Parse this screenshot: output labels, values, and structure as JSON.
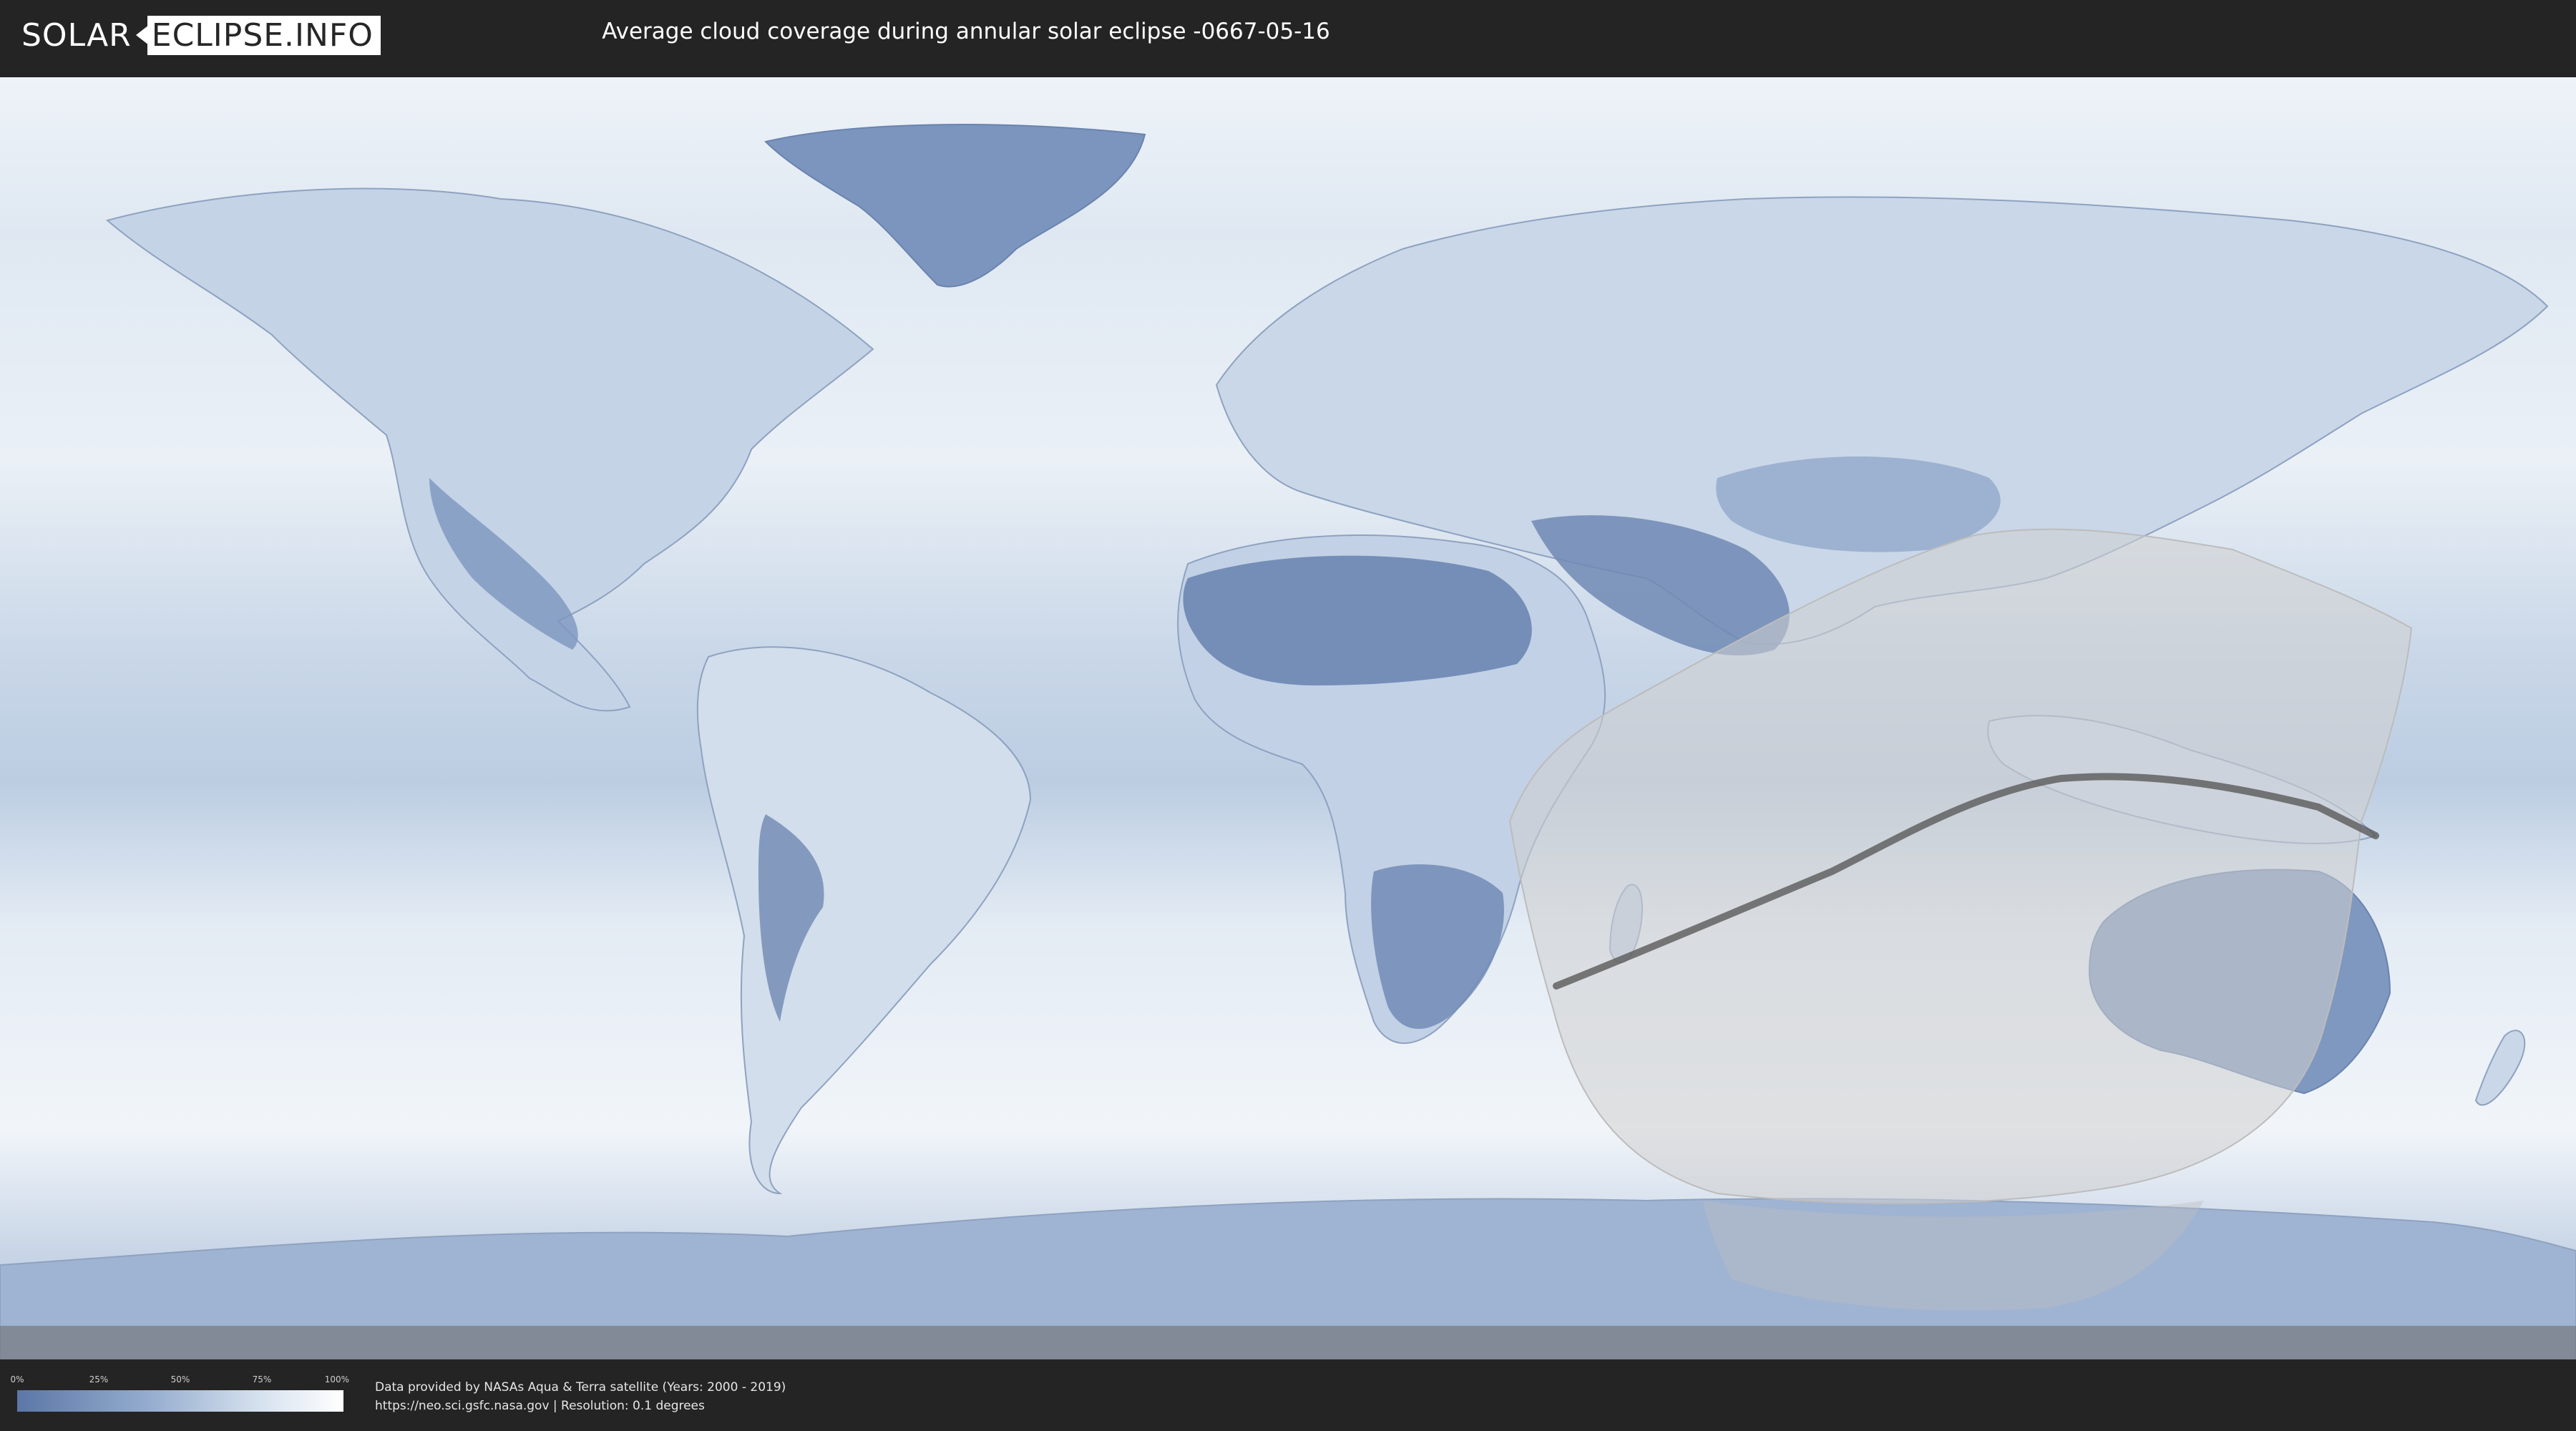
{
  "logo": {
    "left": "SOLAR",
    "right": "ECLIPSE.INFO"
  },
  "title": "Average cloud coverage during annular solar eclipse -0667-05-16",
  "legend": {
    "ticks": [
      "0%",
      "25%",
      "50%",
      "75%",
      "100%"
    ],
    "colors": {
      "low": "#5b77a6",
      "mid": "#94acce",
      "high": "#ffffff"
    }
  },
  "credits": {
    "line1": "Data provided by NASAs Aqua & Terra satellite (Years: 2000 - 2019)",
    "line2": "https://neo.sci.gsfc.nasa.gov | Resolution: 0.1 degrees"
  },
  "map": {
    "colors": {
      "ocean_clouds": "#e3ebf4",
      "land_clear": "#6d87b3",
      "eclipse_zone": "#cfcfcf",
      "central_line": "#5a5a5a"
    }
  }
}
